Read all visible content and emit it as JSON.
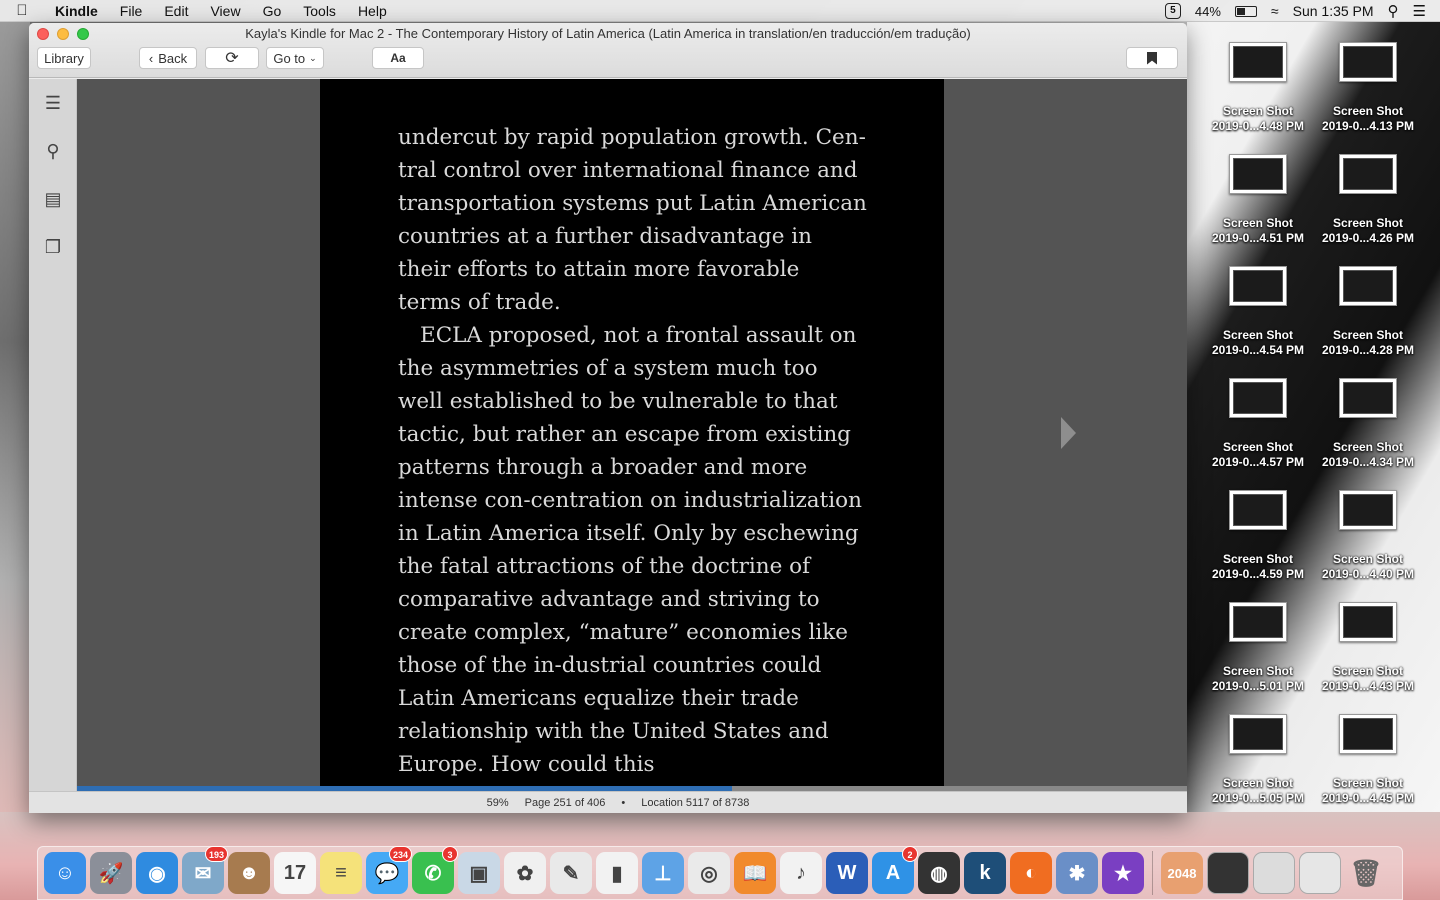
{
  "menubar": {
    "app_name": "Kindle",
    "items": [
      "File",
      "Edit",
      "View",
      "Go",
      "Tools",
      "Help"
    ],
    "status_badge": "5",
    "battery": "44%",
    "clock": "Sun 1:35 PM"
  },
  "window": {
    "title": "Kayla's Kindle for Mac 2 - The Contemporary History of Latin America (Latin America in translation/en traducción/em tradução)",
    "toolbar": {
      "library": "Library",
      "back": "Back",
      "sync_icon": "sync-icon",
      "goto": "Go to",
      "font": "Aa"
    }
  },
  "reader": {
    "paragraphs": [
      "undercut by rapid population growth. Cen-tral control over international finance and transportation systems put Latin American countries at a further disadvantage in their efforts to attain more favorable terms of trade.",
      "ECLA proposed, not a frontal assault on the asymmetries of a system much too well established to be vulnerable to that tactic, but rather an escape from existing patterns through a broader and more intense con-centration on industrialization in Latin America itself. Only by eschewing the fatal attractions of the doctrine of comparative advantage and striving to create complex, “mature” economies like those of the in-dustrial countries could Latin Americans equalize their trade relationship with the United States and Europe. How could this"
    ],
    "progress_fraction": 0.59
  },
  "status": {
    "percent": "59%",
    "page": "Page 251 of 406",
    "separator": "•",
    "location": "Location 5117 of 8738"
  },
  "desktop": {
    "icons": [
      {
        "line1": "Screen Shot",
        "line2": "2019-0...4.48 PM"
      },
      {
        "line1": "Screen Shot",
        "line2": "2019-0...4.13 PM"
      },
      {
        "line1": "Screen Shot",
        "line2": "2019-0...4.51 PM"
      },
      {
        "line1": "Screen Shot",
        "line2": "2019-0...4.26 PM"
      },
      {
        "line1": "Screen Shot",
        "line2": "2019-0...4.54 PM"
      },
      {
        "line1": "Screen Shot",
        "line2": "2019-0...4.28 PM"
      },
      {
        "line1": "Screen Shot",
        "line2": "2019-0...4.57 PM"
      },
      {
        "line1": "Screen Shot",
        "line2": "2019-0...4.34 PM"
      },
      {
        "line1": "Screen Shot",
        "line2": "2019-0...4.59 PM"
      },
      {
        "line1": "Screen Shot",
        "line2": "2019-0...4.40 PM"
      },
      {
        "line1": "Screen Shot",
        "line2": "2019-0...5.01 PM"
      },
      {
        "line1": "Screen Shot",
        "line2": "2019-0...4.43 PM"
      },
      {
        "line1": "Screen Shot",
        "line2": "2019-0...5.05 PM"
      },
      {
        "line1": "Screen Shot",
        "line2": "2019-0...4.45 PM"
      }
    ]
  },
  "dock": {
    "apps": [
      {
        "name": "finder-icon",
        "color": "#3a8fe8",
        "glyph": "☺",
        "badge": ""
      },
      {
        "name": "launchpad-icon",
        "color": "#8b8f99",
        "glyph": "🚀",
        "badge": ""
      },
      {
        "name": "safari-icon",
        "color": "#2f8be0",
        "glyph": "◉",
        "badge": ""
      },
      {
        "name": "mail-icon",
        "color": "#7fa8c9",
        "glyph": "✉",
        "badge": "193"
      },
      {
        "name": "contacts-icon",
        "color": "#a77b4f",
        "glyph": "☻",
        "badge": ""
      },
      {
        "name": "calendar-icon",
        "color": "#f6f6f6",
        "glyph": "17",
        "badge": ""
      },
      {
        "name": "notes-icon",
        "color": "#f5e27a",
        "glyph": "≡",
        "badge": ""
      },
      {
        "name": "messages-icon",
        "color": "#45a9f5",
        "glyph": "💬",
        "badge": "234"
      },
      {
        "name": "facetime-icon",
        "color": "#39c04f",
        "glyph": "✆",
        "badge": "3"
      },
      {
        "name": "preview-icon",
        "color": "#c9d8e6",
        "glyph": "▣",
        "badge": ""
      },
      {
        "name": "photos-icon",
        "color": "#f0f0f0",
        "glyph": "✿",
        "badge": ""
      },
      {
        "name": "keynote-icon",
        "color": "#e9e9e9",
        "glyph": "✎",
        "badge": ""
      },
      {
        "name": "numbers-icon",
        "color": "#f2f2f2",
        "glyph": "▮",
        "badge": ""
      },
      {
        "name": "presentation-icon",
        "color": "#5ea3e6",
        "glyph": "⊥",
        "badge": ""
      },
      {
        "name": "chrome-icon",
        "color": "#eaeaea",
        "glyph": "◎",
        "badge": ""
      },
      {
        "name": "ibooks-icon",
        "color": "#f18a2c",
        "glyph": "📖",
        "badge": ""
      },
      {
        "name": "itunes-icon",
        "color": "#f2f2f2",
        "glyph": "♪",
        "badge": ""
      },
      {
        "name": "word-icon",
        "color": "#2b5eb8",
        "glyph": "W",
        "badge": ""
      },
      {
        "name": "app-store-icon",
        "color": "#2f92e6",
        "glyph": "A",
        "badge": "2"
      },
      {
        "name": "camera-app-icon",
        "color": "#333333",
        "glyph": "◍",
        "badge": ""
      },
      {
        "name": "kindle-icon",
        "color": "#1e4e78",
        "glyph": "k",
        "badge": ""
      },
      {
        "name": "firefox-icon",
        "color": "#f06d21",
        "glyph": "◐",
        "badge": ""
      },
      {
        "name": "bluetooth-icon",
        "color": "#6a8fc7",
        "glyph": "✱",
        "badge": ""
      },
      {
        "name": "imovie-icon",
        "color": "#7a3fc2",
        "glyph": "★",
        "badge": ""
      }
    ],
    "game_label": "2048",
    "recent": [
      {
        "name": "recent-window-1-icon",
        "color": "#333333"
      },
      {
        "name": "recent-window-2-icon",
        "color": "#dcdcdc"
      },
      {
        "name": "recent-window-3-icon",
        "color": "#e6e6e6"
      }
    ],
    "trash": "trash-icon"
  }
}
